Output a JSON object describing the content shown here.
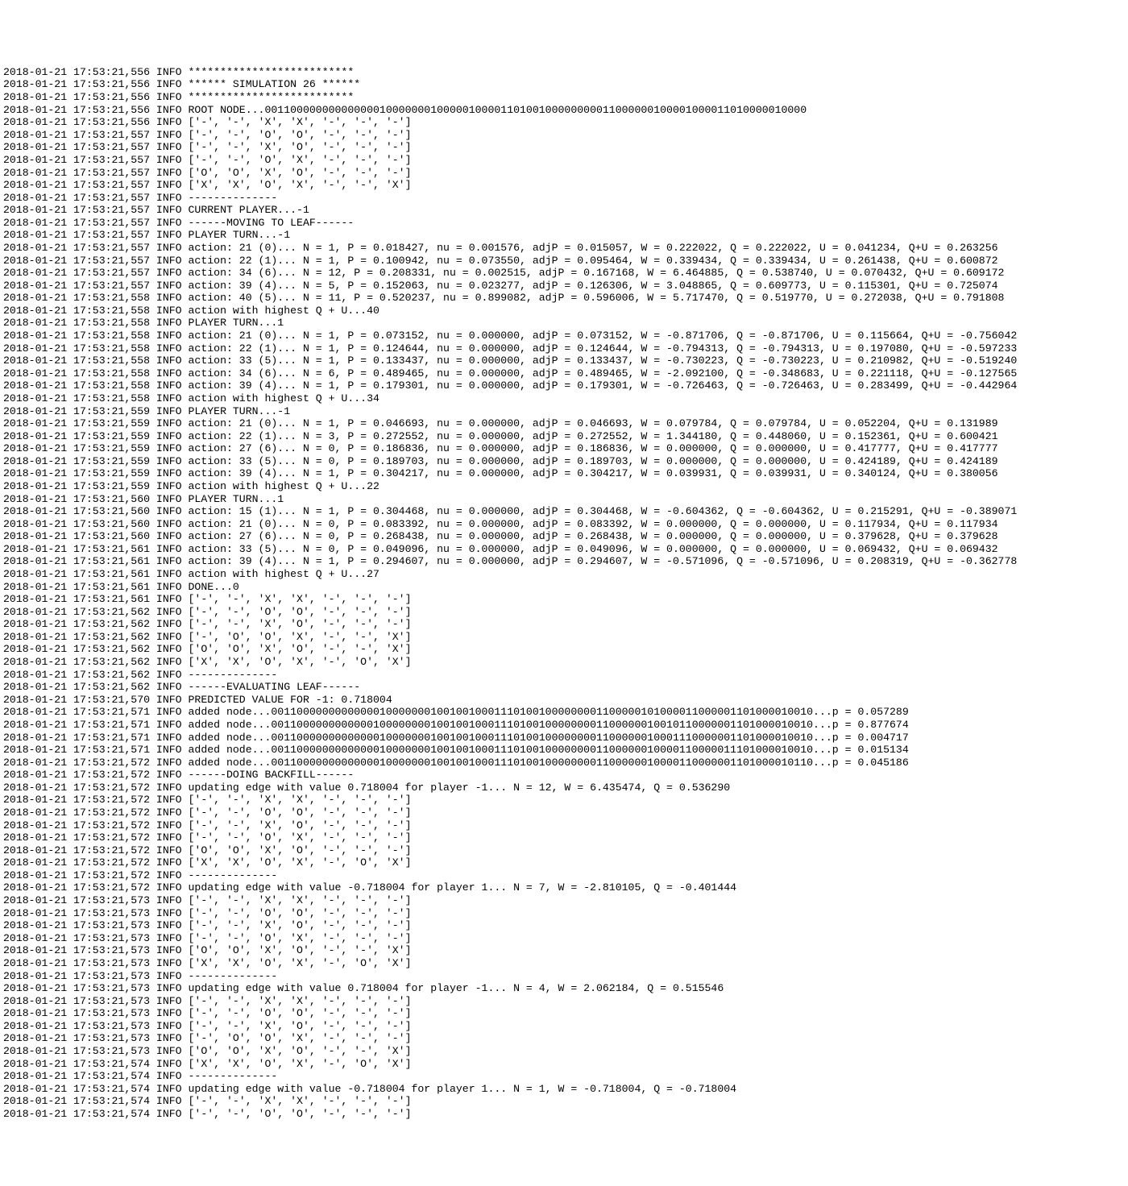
{
  "lines": [
    {
      "ts": "2018-01-21 17:53:21,556",
      "lvl": "INFO",
      "msg": "**************************"
    },
    {
      "ts": "2018-01-21 17:53:21,556",
      "lvl": "INFO",
      "msg": "****** SIMULATION 26 ******"
    },
    {
      "ts": "2018-01-21 17:53:21,556",
      "lvl": "INFO",
      "msg": "**************************"
    },
    {
      "ts": "2018-01-21 17:53:21,556",
      "lvl": "INFO",
      "msg": "ROOT NODE...0011000000000000001000000010000010000110100100000000011000000100001000011010000010000"
    },
    {
      "ts": "2018-01-21 17:53:21,556",
      "lvl": "INFO",
      "msg": "['-', '-', 'X', 'X', '-', '-', '-']"
    },
    {
      "ts": "2018-01-21 17:53:21,557",
      "lvl": "INFO",
      "msg": "['-', '-', 'O', 'O', '-', '-', '-']"
    },
    {
      "ts": "2018-01-21 17:53:21,557",
      "lvl": "INFO",
      "msg": "['-', '-', 'X', 'O', '-', '-', '-']"
    },
    {
      "ts": "2018-01-21 17:53:21,557",
      "lvl": "INFO",
      "msg": "['-', '-', 'O', 'X', '-', '-', '-']"
    },
    {
      "ts": "2018-01-21 17:53:21,557",
      "lvl": "INFO",
      "msg": "['O', 'O', 'X', 'O', '-', '-', '-']"
    },
    {
      "ts": "2018-01-21 17:53:21,557",
      "lvl": "INFO",
      "msg": "['X', 'X', 'O', 'X', '-', '-', 'X']"
    },
    {
      "ts": "2018-01-21 17:53:21,557",
      "lvl": "INFO",
      "msg": "--------------"
    },
    {
      "ts": "2018-01-21 17:53:21,557",
      "lvl": "INFO",
      "msg": "CURRENT PLAYER...-1"
    },
    {
      "ts": "2018-01-21 17:53:21,557",
      "lvl": "INFO",
      "msg": "------MOVING TO LEAF------"
    },
    {
      "ts": "2018-01-21 17:53:21,557",
      "lvl": "INFO",
      "msg": "PLAYER TURN...-1"
    },
    {
      "ts": "2018-01-21 17:53:21,557",
      "lvl": "INFO",
      "msg": "action: 21 (0)... N = 1, P = 0.018427, nu = 0.001576, adjP = 0.015057, W = 0.222022, Q = 0.222022, U = 0.041234, Q+U = 0.263256"
    },
    {
      "ts": "2018-01-21 17:53:21,557",
      "lvl": "INFO",
      "msg": "action: 22 (1)... N = 1, P = 0.100942, nu = 0.073550, adjP = 0.095464, W = 0.339434, Q = 0.339434, U = 0.261438, Q+U = 0.600872"
    },
    {
      "ts": "2018-01-21 17:53:21,557",
      "lvl": "INFO",
      "msg": "action: 34 (6)... N = 12, P = 0.208331, nu = 0.002515, adjP = 0.167168, W = 6.464885, Q = 0.538740, U = 0.070432, Q+U = 0.609172"
    },
    {
      "ts": "2018-01-21 17:53:21,557",
      "lvl": "INFO",
      "msg": "action: 39 (4)... N = 5, P = 0.152063, nu = 0.023277, adjP = 0.126306, W = 3.048865, Q = 0.609773, U = 0.115301, Q+U = 0.725074"
    },
    {
      "ts": "2018-01-21 17:53:21,558",
      "lvl": "INFO",
      "msg": "action: 40 (5)... N = 11, P = 0.520237, nu = 0.899082, adjP = 0.596006, W = 5.717470, Q = 0.519770, U = 0.272038, Q+U = 0.791808"
    },
    {
      "ts": "2018-01-21 17:53:21,558",
      "lvl": "INFO",
      "msg": "action with highest Q + U...40"
    },
    {
      "ts": "2018-01-21 17:53:21,558",
      "lvl": "INFO",
      "msg": "PLAYER TURN...1"
    },
    {
      "ts": "2018-01-21 17:53:21,558",
      "lvl": "INFO",
      "msg": "action: 21 (0)... N = 1, P = 0.073152, nu = 0.000000, adjP = 0.073152, W = -0.871706, Q = -0.871706, U = 0.115664, Q+U = -0.756042"
    },
    {
      "ts": "2018-01-21 17:53:21,558",
      "lvl": "INFO",
      "msg": "action: 22 (1)... N = 1, P = 0.124644, nu = 0.000000, adjP = 0.124644, W = -0.794313, Q = -0.794313, U = 0.197080, Q+U = -0.597233"
    },
    {
      "ts": "2018-01-21 17:53:21,558",
      "lvl": "INFO",
      "msg": "action: 33 (5)... N = 1, P = 0.133437, nu = 0.000000, adjP = 0.133437, W = -0.730223, Q = -0.730223, U = 0.210982, Q+U = -0.519240"
    },
    {
      "ts": "2018-01-21 17:53:21,558",
      "lvl": "INFO",
      "msg": "action: 34 (6)... N = 6, P = 0.489465, nu = 0.000000, adjP = 0.489465, W = -2.092100, Q = -0.348683, U = 0.221118, Q+U = -0.127565"
    },
    {
      "ts": "2018-01-21 17:53:21,558",
      "lvl": "INFO",
      "msg": "action: 39 (4)... N = 1, P = 0.179301, nu = 0.000000, adjP = 0.179301, W = -0.726463, Q = -0.726463, U = 0.283499, Q+U = -0.442964"
    },
    {
      "ts": "2018-01-21 17:53:21,558",
      "lvl": "INFO",
      "msg": "action with highest Q + U...34"
    },
    {
      "ts": "2018-01-21 17:53:21,559",
      "lvl": "INFO",
      "msg": "PLAYER TURN...-1"
    },
    {
      "ts": "2018-01-21 17:53:21,559",
      "lvl": "INFO",
      "msg": "action: 21 (0)... N = 1, P = 0.046693, nu = 0.000000, adjP = 0.046693, W = 0.079784, Q = 0.079784, U = 0.052204, Q+U = 0.131989"
    },
    {
      "ts": "2018-01-21 17:53:21,559",
      "lvl": "INFO",
      "msg": "action: 22 (1)... N = 3, P = 0.272552, nu = 0.000000, adjP = 0.272552, W = 1.344180, Q = 0.448060, U = 0.152361, Q+U = 0.600421"
    },
    {
      "ts": "2018-01-21 17:53:21,559",
      "lvl": "INFO",
      "msg": "action: 27 (6)... N = 0, P = 0.186836, nu = 0.000000, adjP = 0.186836, W = 0.000000, Q = 0.000000, U = 0.417777, Q+U = 0.417777"
    },
    {
      "ts": "2018-01-21 17:53:21,559",
      "lvl": "INFO",
      "msg": "action: 33 (5)... N = 0, P = 0.189703, nu = 0.000000, adjP = 0.189703, W = 0.000000, Q = 0.000000, U = 0.424189, Q+U = 0.424189"
    },
    {
      "ts": "2018-01-21 17:53:21,559",
      "lvl": "INFO",
      "msg": "action: 39 (4)... N = 1, P = 0.304217, nu = 0.000000, adjP = 0.304217, W = 0.039931, Q = 0.039931, U = 0.340124, Q+U = 0.380056"
    },
    {
      "ts": "2018-01-21 17:53:21,559",
      "lvl": "INFO",
      "msg": "action with highest Q + U...22"
    },
    {
      "ts": "2018-01-21 17:53:21,560",
      "lvl": "INFO",
      "msg": "PLAYER TURN...1"
    },
    {
      "ts": "2018-01-21 17:53:21,560",
      "lvl": "INFO",
      "msg": "action: 15 (1)... N = 1, P = 0.304468, nu = 0.000000, adjP = 0.304468, W = -0.604362, Q = -0.604362, U = 0.215291, Q+U = -0.389071"
    },
    {
      "ts": "2018-01-21 17:53:21,560",
      "lvl": "INFO",
      "msg": "action: 21 (0)... N = 0, P = 0.083392, nu = 0.000000, adjP = 0.083392, W = 0.000000, Q = 0.000000, U = 0.117934, Q+U = 0.117934"
    },
    {
      "ts": "2018-01-21 17:53:21,560",
      "lvl": "INFO",
      "msg": "action: 27 (6)... N = 0, P = 0.268438, nu = 0.000000, adjP = 0.268438, W = 0.000000, Q = 0.000000, U = 0.379628, Q+U = 0.379628"
    },
    {
      "ts": "2018-01-21 17:53:21,561",
      "lvl": "INFO",
      "msg": "action: 33 (5)... N = 0, P = 0.049096, nu = 0.000000, adjP = 0.049096, W = 0.000000, Q = 0.000000, U = 0.069432, Q+U = 0.069432"
    },
    {
      "ts": "2018-01-21 17:53:21,561",
      "lvl": "INFO",
      "msg": "action: 39 (4)... N = 1, P = 0.294607, nu = 0.000000, adjP = 0.294607, W = -0.571096, Q = -0.571096, U = 0.208319, Q+U = -0.362778"
    },
    {
      "ts": "2018-01-21 17:53:21,561",
      "lvl": "INFO",
      "msg": "action with highest Q + U...27"
    },
    {
      "ts": "2018-01-21 17:53:21,561",
      "lvl": "INFO",
      "msg": "DONE...0"
    },
    {
      "ts": "2018-01-21 17:53:21,561",
      "lvl": "INFO",
      "msg": "['-', '-', 'X', 'X', '-', '-', '-']"
    },
    {
      "ts": "2018-01-21 17:53:21,562",
      "lvl": "INFO",
      "msg": "['-', '-', 'O', 'O', '-', '-', '-']"
    },
    {
      "ts": "2018-01-21 17:53:21,562",
      "lvl": "INFO",
      "msg": "['-', '-', 'X', 'O', '-', '-', '-']"
    },
    {
      "ts": "2018-01-21 17:53:21,562",
      "lvl": "INFO",
      "msg": "['-', 'O', 'O', 'X', '-', '-', 'X']"
    },
    {
      "ts": "2018-01-21 17:53:21,562",
      "lvl": "INFO",
      "msg": "['O', 'O', 'X', 'O', '-', '-', 'X']"
    },
    {
      "ts": "2018-01-21 17:53:21,562",
      "lvl": "INFO",
      "msg": "['X', 'X', 'O', 'X', '-', 'O', 'X']"
    },
    {
      "ts": "2018-01-21 17:53:21,562",
      "lvl": "INFO",
      "msg": "--------------"
    },
    {
      "ts": "2018-01-21 17:53:21,562",
      "lvl": "INFO",
      "msg": "------EVALUATING LEAF------"
    },
    {
      "ts": "2018-01-21 17:53:21,570",
      "lvl": "INFO",
      "msg": "PREDICTED VALUE FOR -1: 0.718004"
    },
    {
      "ts": "2018-01-21 17:53:21,571",
      "lvl": "INFO",
      "msg": "added node...0011000000000000010000000100100100011101001000000001100000101000011000001101000010010...p = 0.057289"
    },
    {
      "ts": "2018-01-21 17:53:21,571",
      "lvl": "INFO",
      "msg": "added node...0011000000000000100000000100100100011101001000000001100000010010110000001101000010010...p = 0.877674"
    },
    {
      "ts": "2018-01-21 17:53:21,571",
      "lvl": "INFO",
      "msg": "added node...0011000000000000010000000100100100011101001000000001100000010001110000001101000010010...p = 0.004717"
    },
    {
      "ts": "2018-01-21 17:53:21,571",
      "lvl": "INFO",
      "msg": "added node...0011000000000000010000000100100100011101001000000001100000010000110000011101000010010...p = 0.015134"
    },
    {
      "ts": "2018-01-21 17:53:21,572",
      "lvl": "INFO",
      "msg": "added node...0011000000000000010000000100100100011101001000000001100000010000110000001101000010110...p = 0.045186"
    },
    {
      "ts": "2018-01-21 17:53:21,572",
      "lvl": "INFO",
      "msg": "------DOING BACKFILL------"
    },
    {
      "ts": "2018-01-21 17:53:21,572",
      "lvl": "INFO",
      "msg": "updating edge with value 0.718004 for player -1... N = 12, W = 6.435474, Q = 0.536290"
    },
    {
      "ts": "2018-01-21 17:53:21,572",
      "lvl": "INFO",
      "msg": "['-', '-', 'X', 'X', '-', '-', '-']"
    },
    {
      "ts": "2018-01-21 17:53:21,572",
      "lvl": "INFO",
      "msg": "['-', '-', 'O', 'O', '-', '-', '-']"
    },
    {
      "ts": "2018-01-21 17:53:21,572",
      "lvl": "INFO",
      "msg": "['-', '-', 'X', 'O', '-', '-', '-']"
    },
    {
      "ts": "2018-01-21 17:53:21,572",
      "lvl": "INFO",
      "msg": "['-', '-', 'O', 'X', '-', '-', '-']"
    },
    {
      "ts": "2018-01-21 17:53:21,572",
      "lvl": "INFO",
      "msg": "['O', 'O', 'X', 'O', '-', '-', '-']"
    },
    {
      "ts": "2018-01-21 17:53:21,572",
      "lvl": "INFO",
      "msg": "['X', 'X', 'O', 'X', '-', 'O', 'X']"
    },
    {
      "ts": "2018-01-21 17:53:21,572",
      "lvl": "INFO",
      "msg": "--------------"
    },
    {
      "ts": "2018-01-21 17:53:21,572",
      "lvl": "INFO",
      "msg": "updating edge with value -0.718004 for player 1... N = 7, W = -2.810105, Q = -0.401444"
    },
    {
      "ts": "2018-01-21 17:53:21,573",
      "lvl": "INFO",
      "msg": "['-', '-', 'X', 'X', '-', '-', '-']"
    },
    {
      "ts": "2018-01-21 17:53:21,573",
      "lvl": "INFO",
      "msg": "['-', '-', 'O', 'O', '-', '-', '-']"
    },
    {
      "ts": "2018-01-21 17:53:21,573",
      "lvl": "INFO",
      "msg": "['-', '-', 'X', 'O', '-', '-', '-']"
    },
    {
      "ts": "2018-01-21 17:53:21,573",
      "lvl": "INFO",
      "msg": "['-', '-', 'O', 'X', '-', '-', '-']"
    },
    {
      "ts": "2018-01-21 17:53:21,573",
      "lvl": "INFO",
      "msg": "['O', 'O', 'X', 'O', '-', '-', 'X']"
    },
    {
      "ts": "2018-01-21 17:53:21,573",
      "lvl": "INFO",
      "msg": "['X', 'X', 'O', 'X', '-', 'O', 'X']"
    },
    {
      "ts": "2018-01-21 17:53:21,573",
      "lvl": "INFO",
      "msg": "--------------"
    },
    {
      "ts": "2018-01-21 17:53:21,573",
      "lvl": "INFO",
      "msg": "updating edge with value 0.718004 for player -1... N = 4, W = 2.062184, Q = 0.515546"
    },
    {
      "ts": "2018-01-21 17:53:21,573",
      "lvl": "INFO",
      "msg": "['-', '-', 'X', 'X', '-', '-', '-']"
    },
    {
      "ts": "2018-01-21 17:53:21,573",
      "lvl": "INFO",
      "msg": "['-', '-', 'O', 'O', '-', '-', '-']"
    },
    {
      "ts": "2018-01-21 17:53:21,573",
      "lvl": "INFO",
      "msg": "['-', '-', 'X', 'O', '-', '-', '-']"
    },
    {
      "ts": "2018-01-21 17:53:21,573",
      "lvl": "INFO",
      "msg": "['-', 'O', 'O', 'X', '-', '-', '-']"
    },
    {
      "ts": "2018-01-21 17:53:21,573",
      "lvl": "INFO",
      "msg": "['O', 'O', 'X', 'O', '-', '-', 'X']"
    },
    {
      "ts": "2018-01-21 17:53:21,574",
      "lvl": "INFO",
      "msg": "['X', 'X', 'O', 'X', '-', 'O', 'X']"
    },
    {
      "ts": "2018-01-21 17:53:21,574",
      "lvl": "INFO",
      "msg": "--------------"
    },
    {
      "ts": "2018-01-21 17:53:21,574",
      "lvl": "INFO",
      "msg": "updating edge with value -0.718004 for player 1... N = 1, W = -0.718004, Q = -0.718004"
    },
    {
      "ts": "2018-01-21 17:53:21,574",
      "lvl": "INFO",
      "msg": "['-', '-', 'X', 'X', '-', '-', '-']"
    },
    {
      "ts": "2018-01-21 17:53:21,574",
      "lvl": "INFO",
      "msg": "['-', '-', 'O', 'O', '-', '-', '-']"
    }
  ]
}
